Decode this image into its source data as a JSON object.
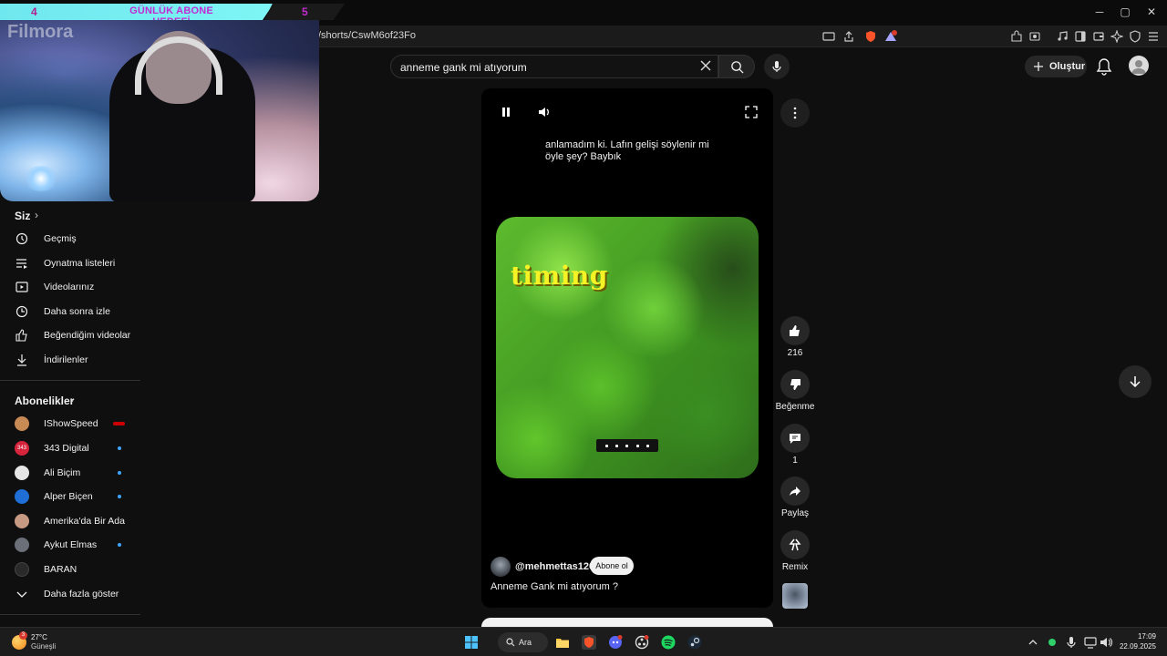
{
  "overlay": {
    "banner_left": "4",
    "banner_title": "GÜNLÜK ABONE HEDEFİ",
    "banner_right": "5",
    "webcam_logo": "Filmora"
  },
  "browser": {
    "url": "/shorts/CswM6of23Fo",
    "window_controls": {
      "minimize": "─",
      "maximize": "▢",
      "close": "✕"
    },
    "brave_badge": "9"
  },
  "header": {
    "search_value": "anneme gank mi atıyorum",
    "create_label": "Oluştur"
  },
  "sidebar": {
    "you_heading": "Siz",
    "you_items": [
      {
        "label": "Geçmiş",
        "icon": "history-icon"
      },
      {
        "label": "Oynatma listeleri",
        "icon": "playlist-icon"
      },
      {
        "label": "Videolarınız",
        "icon": "your-videos-icon"
      },
      {
        "label": "Daha sonra izle",
        "icon": "watch-later-icon"
      },
      {
        "label": "Beğendiğim videolar",
        "icon": "liked-icon"
      },
      {
        "label": "İndirilenler",
        "icon": "download-icon"
      }
    ],
    "subs_heading": "Abonelikler",
    "subscriptions": [
      {
        "label": "IShowSpeed",
        "indicator": "live",
        "color": "#c78a54"
      },
      {
        "label": "343 Digital",
        "indicator": "new",
        "color": "#d6243c",
        "avatar_text": "343"
      },
      {
        "label": "Ali Biçim",
        "indicator": "new",
        "color": "#e6e6e6"
      },
      {
        "label": "Alper Biçen",
        "indicator": "new",
        "color": "#1f6fd6"
      },
      {
        "label": "Amerika'da Bir Ada",
        "indicator": "none",
        "color": "#c79a83"
      },
      {
        "label": "Aykut Elmas",
        "indicator": "new",
        "color": "#6a6f78"
      },
      {
        "label": "BARAN",
        "indicator": "none",
        "color": "#2a2a2a"
      }
    ],
    "show_more": "Daha fazla göster"
  },
  "short": {
    "caption": "anlamadım ki. Lafın gelişi söylenir mi öyle şey? Baybık",
    "overlay_text": "timing",
    "channel": "@mehmettas1206",
    "subscribe_label": "Abone ol",
    "title": "Anneme Gank mi atıyorum ?"
  },
  "actions": {
    "likes": "216",
    "dislike_label": "Beğenme",
    "comments": "1",
    "share_label": "Paylaş",
    "remix_label": "Remix"
  },
  "taskbar": {
    "weather_temp": "27°C",
    "weather_desc": "Güneşli",
    "weather_badge": "3",
    "search_label": "Ara",
    "time": "17:09",
    "date": "22.09.2025"
  },
  "colors": {
    "accent_blue": "#3ea6ff",
    "banner_cyan": "#6fe7ee",
    "banner_magenta": "#c22bd1",
    "timing_yellow": "#f5f226"
  }
}
